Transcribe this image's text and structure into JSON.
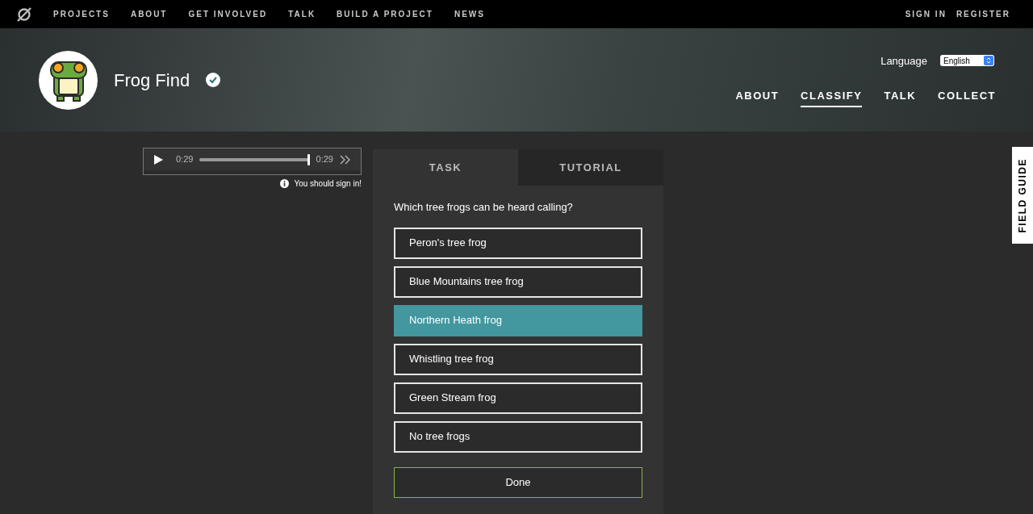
{
  "top_nav": {
    "links": [
      "PROJECTS",
      "ABOUT",
      "GET INVOLVED",
      "TALK",
      "BUILD A PROJECT",
      "NEWS"
    ],
    "account": [
      "SIGN IN",
      "REGISTER"
    ]
  },
  "project": {
    "title": "Frog Find",
    "verified": true,
    "language_label": "Language",
    "language": "English",
    "nav": [
      {
        "label": "ABOUT",
        "selected": false
      },
      {
        "label": "CLASSIFY",
        "selected": true
      },
      {
        "label": "TALK",
        "selected": false
      },
      {
        "label": "COLLECT",
        "selected": false
      }
    ]
  },
  "player": {
    "current": "0:29",
    "duration": "0:29",
    "level": 1,
    "notice": "You should sign in!"
  },
  "task": {
    "tabs": [
      {
        "label": "TASK",
        "selected": true
      },
      {
        "label": "TUTORIAL",
        "selected": false
      }
    ],
    "question": "Which tree frogs can be heard calling?",
    "options": [
      {
        "label": "Peron's tree frog",
        "selected": false
      },
      {
        "label": "Blue Mountains tree frog",
        "selected": false
      },
      {
        "label": "Northern Heath frog",
        "selected": true
      },
      {
        "label": "Whistling tree frog",
        "selected": false
      },
      {
        "label": "Green Stream frog",
        "selected": false
      },
      {
        "label": "No tree frogs",
        "selected": false
      }
    ],
    "done": "Done"
  },
  "field_guide": "FIELD GUIDE"
}
